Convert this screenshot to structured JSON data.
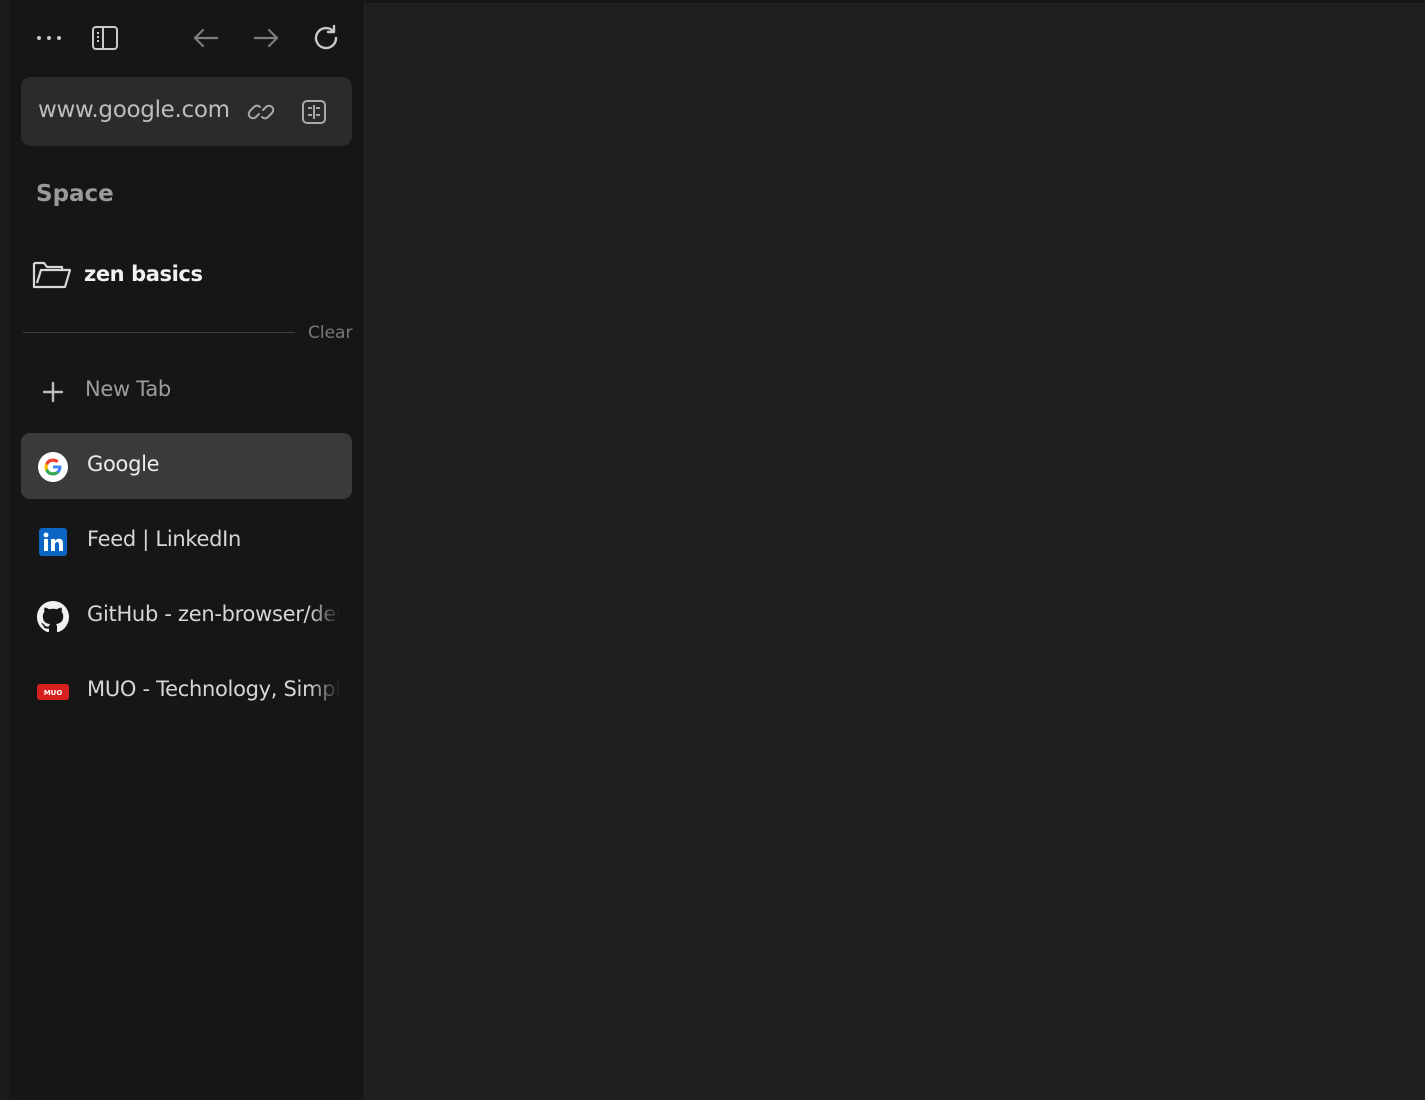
{
  "url_bar": {
    "url": "www.google.com"
  },
  "sidebar": {
    "space_label": "Space",
    "folder": {
      "label": "zen basics"
    },
    "clear_label": "Clear",
    "new_tab_label": "New Tab",
    "tabs": [
      {
        "title": "Google",
        "icon": "google-icon",
        "active": true
      },
      {
        "title": "Feed | LinkedIn",
        "icon": "linkedin-icon",
        "active": false
      },
      {
        "title": "GitHub - zen-browser/desktop",
        "icon": "github-icon",
        "active": false
      },
      {
        "title": "MUO - Technology, Simplified.",
        "icon": "muo-icon",
        "active": false
      }
    ]
  },
  "colors": {
    "sidebar_bg": "#161616",
    "content_bg": "#1f1f1f",
    "url_bar_bg": "#2b2b2b",
    "active_tab_bg": "#3a3a3a",
    "linkedin_blue": "#0a66c2",
    "muo_red": "#d6201e"
  }
}
